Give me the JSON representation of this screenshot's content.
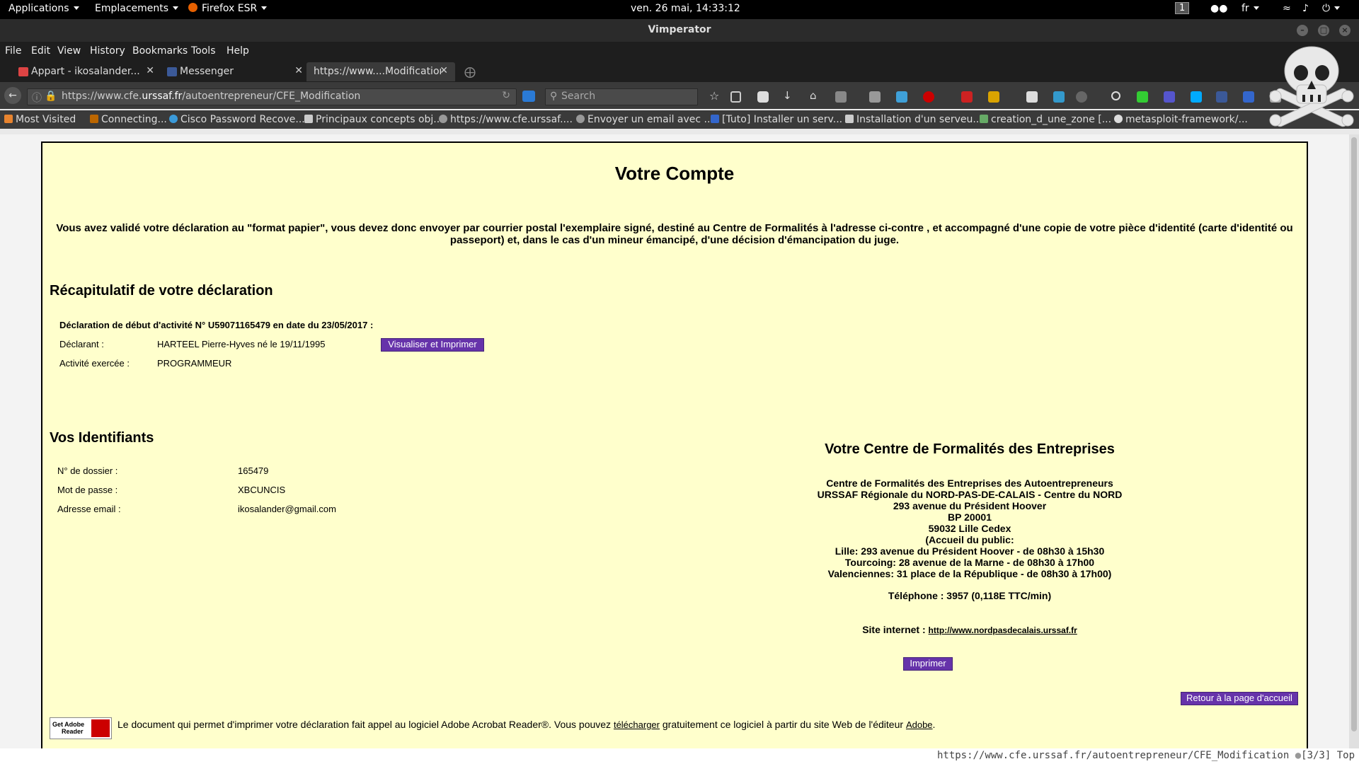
{
  "topbar": {
    "applications": "Applications",
    "places": "Emplacements",
    "firefox": "Firefox ESR",
    "clock": "ven. 26 mai, 14:33:12",
    "workspace": "1",
    "lang": "fr"
  },
  "window": {
    "title": "Vimperator"
  },
  "menu": [
    "File",
    "Edit",
    "View",
    "History",
    "Bookmarks",
    "Tools",
    "Help"
  ],
  "tabs": [
    {
      "label": "Appart - ikosalander...",
      "icon": "gmail-icon",
      "active": false
    },
    {
      "label": "Messenger",
      "icon": "facebook-icon",
      "active": false
    },
    {
      "label": "https://www....Modification",
      "icon": "",
      "active": true
    }
  ],
  "nav": {
    "url_prefix": "https://www.cfe.",
    "url_domain": "urssaf.fr",
    "url_path": "/autoentrepreneur/CFE_Modification",
    "search_placeholder": "Search"
  },
  "bookmarks": [
    "Most Visited",
    "Connecting...",
    "Cisco Password Recove...",
    "Principaux concepts obj...",
    "https://www.cfe.urssaf....",
    "Envoyer un email avec ...",
    "[Tuto] Installer un serv...",
    "Installation d'un serveu...",
    "creation_d_une_zone [...",
    "metasploit-framework/..."
  ],
  "page": {
    "title": "Votre Compte",
    "notice_line1": "Vous avez validé votre déclaration au \"format papier\", vous devez donc envoyer par courrier postal l'exemplaire signé, destiné au Centre de Formalités à l'adresse ci-contre , et accompagné d'une copie de votre pièce d'identité (carte d'identité ou",
    "notice_line2": "passeport) et, dans le cas d'un mineur émancipé, d'une décision d'émancipation du juge.",
    "recap_heading": "Récapitulatif de votre déclaration",
    "declaration_line": "Déclaration de début d'activité N° U59071165479 en date du 23/05/2017 :",
    "declarant_label": "Déclarant :",
    "declarant_value": "HARTEEL Pierre-Hyves né le 19/11/1995",
    "view_print_button": "Visualiser et Imprimer",
    "activity_label": "Activité exercée :",
    "activity_value": "PROGRAMMEUR",
    "ids_heading": "Vos Identifiants",
    "ids": [
      {
        "label": "N° de dossier :",
        "value": "165479"
      },
      {
        "label": "Mot de passe :",
        "value": "XBCUNCIS"
      },
      {
        "label": "Adresse email :",
        "value": "ikosalander@gmail.com"
      }
    ],
    "cfe_heading": "Votre Centre de Formalités des Entreprises",
    "cfe_lines": [
      "Centre de Formalités des Entreprises des Autoentrepreneurs",
      "URSSAF Régionale du NORD-PAS-DE-CALAIS - Centre du NORD",
      "293 avenue du Président Hoover",
      "BP 20001",
      "59032 Lille Cedex",
      "(Accueil du public:",
      "Lille: 293 avenue du Président Hoover - de 08h30 à 15h30",
      "Tourcoing: 28 avenue de la Marne - de 08h30 à 17h00",
      "Valenciennes: 31 place de la République - de 08h30 à 17h00)"
    ],
    "phone": "Téléphone : 3957 (0,118E TTC/min)",
    "site_label": "Site internet :",
    "site_url": "http://www.nordpasdecalais.urssaf.fr",
    "print_button": "Imprimer",
    "home_button": "Retour à la page d'accueil",
    "adobe_badge_line1": "Get Adobe",
    "adobe_badge_line2": "Reader",
    "adobe_text_before": "Le document qui permet d'imprimer votre déclaration fait appel au logiciel Adobe Acrobat Reader®. Vous pouvez",
    "adobe_link_download": "télécharger",
    "adobe_text_middle": "gratuitement ce logiciel à partir du site Web de l'éditeur",
    "adobe_link_adobe": "Adobe",
    "adobe_text_end": "."
  },
  "status": {
    "url": "https://www.cfe.urssaf.fr/autoentrepreneur/CFE_Modification",
    "position": "[3/3] Top"
  },
  "colors": {
    "page_bg": "#ffffcc",
    "button": "#6633aa",
    "chrome_dark": "#1e1e1e"
  }
}
